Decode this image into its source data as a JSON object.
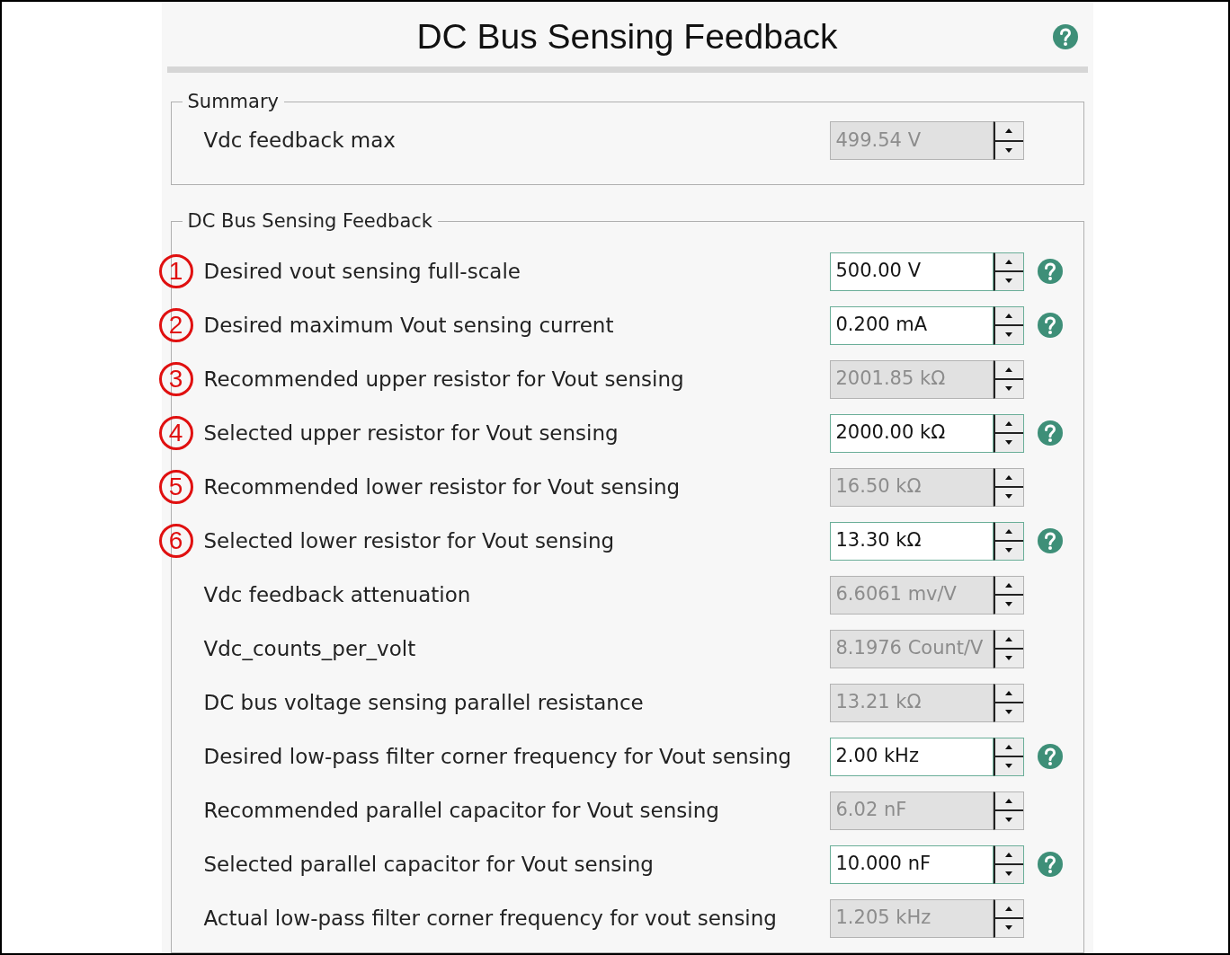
{
  "panel": {
    "title": "DC Bus Sensing Feedback",
    "help": true
  },
  "sections": [
    {
      "legend": "Summary",
      "rows": [
        {
          "label": "Vdc feedback max",
          "value": "499.54 V",
          "disabled": true,
          "help": false
        }
      ]
    },
    {
      "legend": "DC Bus Sensing Feedback",
      "rows": [
        {
          "marker": "1",
          "label": "Desired vout sensing full-scale",
          "value": "500.00 V",
          "disabled": false,
          "help": true
        },
        {
          "marker": "2",
          "label": "Desired maximum Vout sensing current",
          "value": "0.200 mA",
          "disabled": false,
          "help": true
        },
        {
          "marker": "3",
          "label": "Recommended upper resistor for Vout sensing",
          "value": "2001.85 kΩ",
          "disabled": true,
          "help": false
        },
        {
          "marker": "4",
          "label": "Selected upper resistor for Vout sensing",
          "value": "2000.00 kΩ",
          "disabled": false,
          "help": true
        },
        {
          "marker": "5",
          "label": "Recommended lower resistor for Vout sensing",
          "value": "16.50 kΩ",
          "disabled": true,
          "help": false
        },
        {
          "marker": "6",
          "label": "Selected lower resistor for Vout sensing",
          "value": "13.30 kΩ",
          "disabled": false,
          "help": true
        },
        {
          "label": "Vdc feedback attenuation",
          "value": "6.6061 mv/V",
          "disabled": true,
          "help": false
        },
        {
          "label": "Vdc_counts_per_volt",
          "value": "8.1976 Count/V",
          "disabled": true,
          "help": false
        },
        {
          "label": "DC bus voltage sensing parallel resistance",
          "value": "13.21 kΩ",
          "disabled": true,
          "help": false
        },
        {
          "label": "Desired low-pass filter corner frequency for Vout sensing",
          "value": "2.00 kHz",
          "disabled": false,
          "help": true
        },
        {
          "label": "Recommended parallel capacitor for Vout sensing",
          "value": "6.02 nF",
          "disabled": true,
          "help": false
        },
        {
          "label": "Selected parallel capacitor for Vout sensing",
          "value": "10.000 nF",
          "disabled": false,
          "help": true
        },
        {
          "label": "Actual low-pass filter corner frequency for vout sensing",
          "value": "1.205 kHz",
          "disabled": true,
          "help": false
        }
      ]
    }
  ]
}
